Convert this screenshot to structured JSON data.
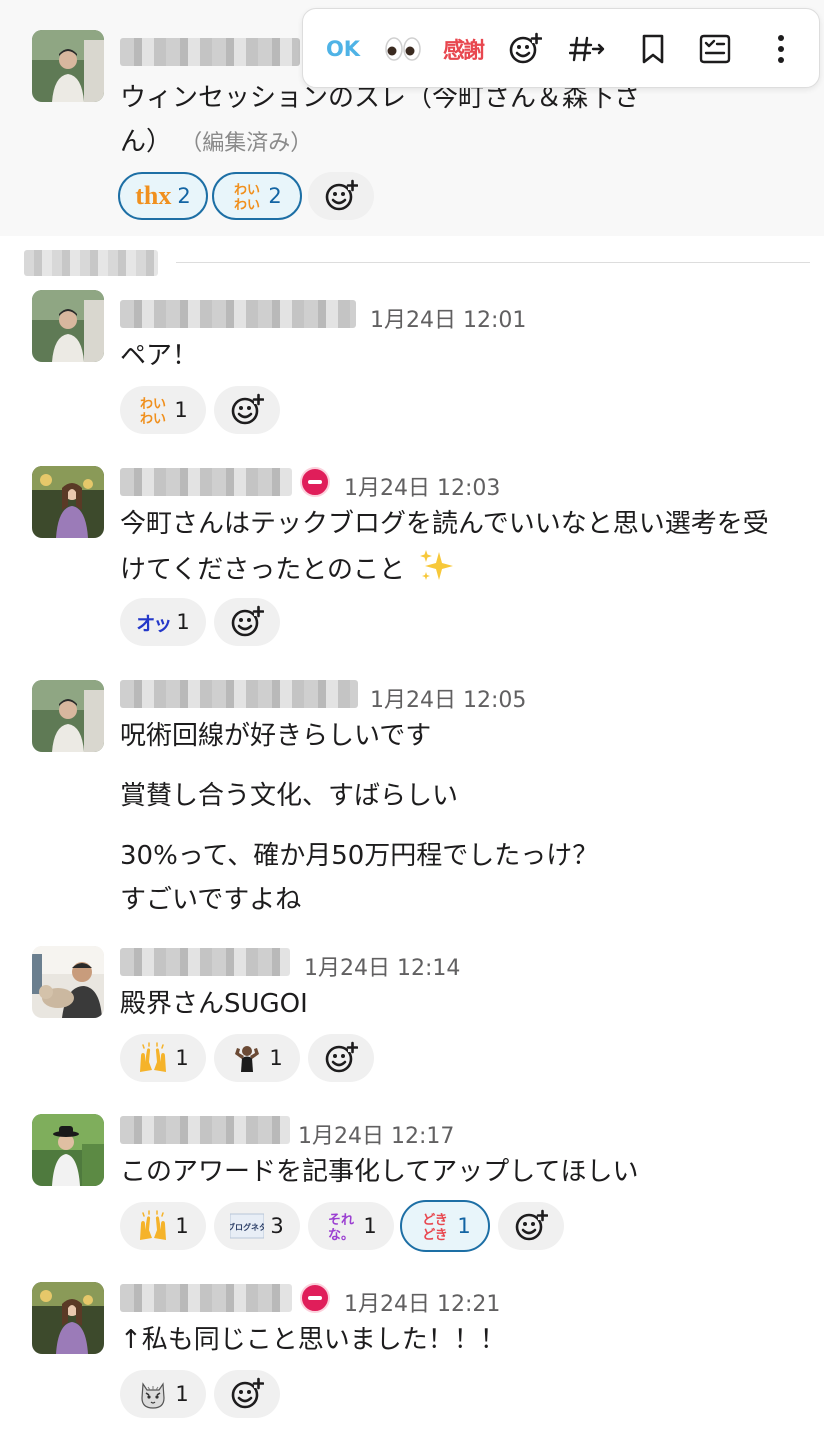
{
  "toolbar": {
    "ok": "OK",
    "kansha": "感謝",
    "icons": [
      "ok-emoji",
      "eyes-emoji",
      "kansha-emoji",
      "add-reaction-icon",
      "reply-in-channel-icon",
      "bookmark-icon",
      "add-task-icon",
      "more-icon"
    ]
  },
  "messages": [
    {
      "text_line1": "ウィンセッションのスレ（今町さん＆森下さ",
      "text_line2": "ん）",
      "edited": "（編集済み）",
      "reactions": [
        {
          "emoji": "thx",
          "count": "2"
        },
        {
          "emoji": "わいわい",
          "count": "2"
        }
      ]
    },
    {
      "time": "1月24日 12:01",
      "text": "ペア！",
      "reactions": [
        {
          "emoji": "わいわい",
          "count": "1"
        }
      ]
    },
    {
      "time": "1月24日 12:03",
      "text_line1": "今町さんはテックブログを読んでいいなと思い選考を受",
      "text_line2": "けてくださったとのこと",
      "reactions": [
        {
          "emoji": "オッ",
          "count": "1"
        }
      ]
    },
    {
      "time": "1月24日 12:05",
      "lines": [
        "呪術回線が好きらしいです",
        "賞賛し合う文化、すばらしい",
        "30%って、確か月50万円程でしたっけ？",
        "すごいですよね"
      ]
    },
    {
      "time": "1月24日 12:14",
      "text": "殿界さんSUGOI",
      "reactions": [
        {
          "emoji": "raised-hands",
          "count": "1"
        },
        {
          "emoji": "flexing-man",
          "count": "1"
        }
      ]
    },
    {
      "time": "1月24日 12:17",
      "text": "このアワードを記事化してアップしてほしい",
      "reactions": [
        {
          "emoji": "raised-hands",
          "count": "1"
        },
        {
          "emoji": "ブログネタ",
          "count": "3"
        },
        {
          "emoji": "それな。",
          "count": "1"
        },
        {
          "emoji": "どきどき",
          "count": "1"
        }
      ]
    },
    {
      "time": "1月24日 12:21",
      "text": "↑私も同じこと思いました！！！",
      "reactions": [
        {
          "emoji": "cat",
          "count": "1"
        }
      ]
    }
  ],
  "colors": {
    "accent_blue": "#1264a3",
    "dnd_red": "#e01e5a",
    "kansha_red": "#e8474f",
    "ok_blue": "#4fb3e6"
  }
}
